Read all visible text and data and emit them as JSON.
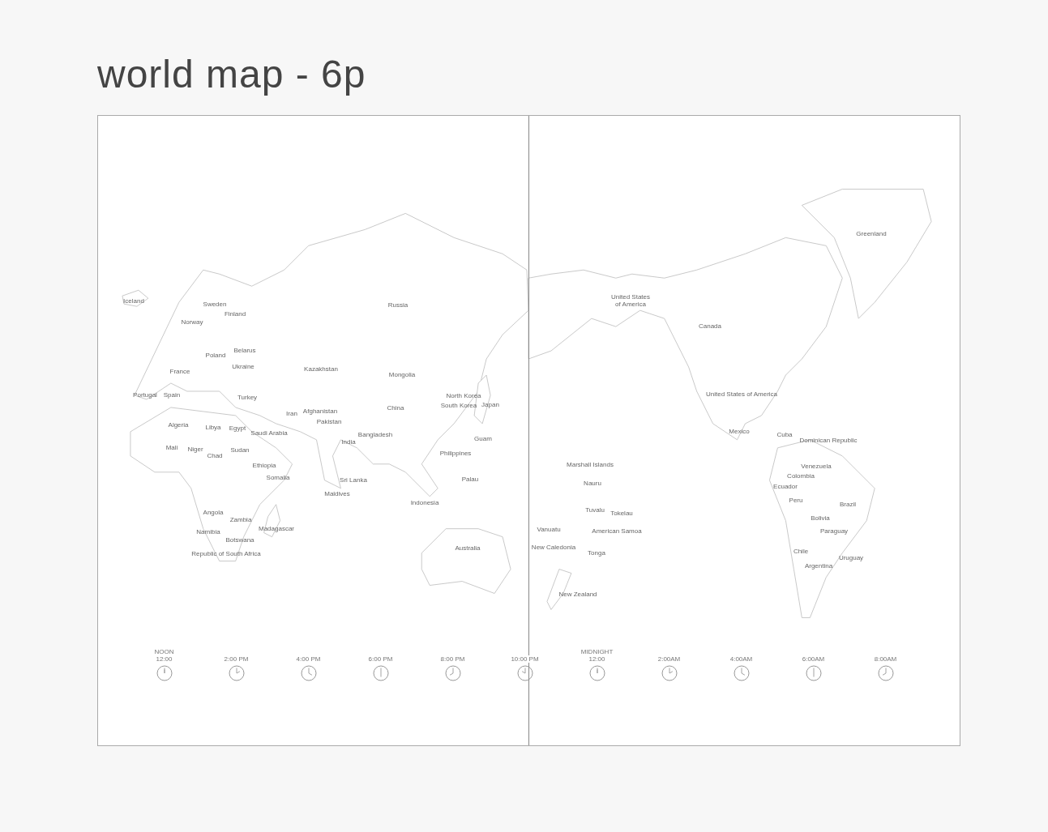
{
  "title": "world map - 6p",
  "map_labels": [
    {
      "lines": [
        "Iceland"
      ]
    },
    {
      "lines": [
        "Sweden"
      ]
    },
    {
      "lines": [
        "Norway"
      ]
    },
    {
      "lines": [
        "Finland"
      ]
    },
    {
      "lines": [
        "Russia"
      ]
    },
    {
      "lines": [
        "Poland"
      ]
    },
    {
      "lines": [
        "Belarus"
      ]
    },
    {
      "lines": [
        "Ukraine"
      ]
    },
    {
      "lines": [
        "France"
      ]
    },
    {
      "lines": [
        "Portugal"
      ]
    },
    {
      "lines": [
        "Spain"
      ]
    },
    {
      "lines": [
        "Turkey"
      ]
    },
    {
      "lines": [
        "Kazakhstan"
      ]
    },
    {
      "lines": [
        "Mongolia"
      ]
    },
    {
      "lines": [
        "China"
      ]
    },
    {
      "lines": [
        "North Korea"
      ]
    },
    {
      "lines": [
        "South Korea"
      ]
    },
    {
      "lines": [
        "Japan"
      ]
    },
    {
      "lines": [
        "Iran"
      ]
    },
    {
      "lines": [
        "Afghanistan"
      ]
    },
    {
      "lines": [
        "Pakistan"
      ]
    },
    {
      "lines": [
        "Algeria"
      ]
    },
    {
      "lines": [
        "Libya"
      ]
    },
    {
      "lines": [
        "Egypt"
      ]
    },
    {
      "lines": [
        "Saudi Arabia"
      ]
    },
    {
      "lines": [
        "India"
      ]
    },
    {
      "lines": [
        "Bangladesh"
      ]
    },
    {
      "lines": [
        "Mali"
      ]
    },
    {
      "lines": [
        "Niger"
      ]
    },
    {
      "lines": [
        "Chad"
      ]
    },
    {
      "lines": [
        "Sudan"
      ]
    },
    {
      "lines": [
        "Ethiopia"
      ]
    },
    {
      "lines": [
        "Somalia"
      ]
    },
    {
      "lines": [
        "Sri Lanka"
      ]
    },
    {
      "lines": [
        "Maldives"
      ]
    },
    {
      "lines": [
        "Philippines"
      ]
    },
    {
      "lines": [
        "Guam"
      ]
    },
    {
      "lines": [
        "Palau"
      ]
    },
    {
      "lines": [
        "Indonesia"
      ]
    },
    {
      "lines": [
        "Angola"
      ]
    },
    {
      "lines": [
        "Zambia"
      ]
    },
    {
      "lines": [
        "Namibia"
      ]
    },
    {
      "lines": [
        "Botswana"
      ]
    },
    {
      "lines": [
        "Madagascar"
      ]
    },
    {
      "lines": [
        "Republic of South Africa"
      ]
    },
    {
      "lines": [
        "Australia"
      ]
    },
    {
      "lines": [
        "New Zealand"
      ]
    },
    {
      "lines": [
        "Marshall Islands"
      ]
    },
    {
      "lines": [
        "Nauru"
      ]
    },
    {
      "lines": [
        "Tuvalu"
      ]
    },
    {
      "lines": [
        "Tokelau"
      ]
    },
    {
      "lines": [
        "Vanuatu"
      ]
    },
    {
      "lines": [
        "American Samoa"
      ]
    },
    {
      "lines": [
        "New Caledonia"
      ]
    },
    {
      "lines": [
        "Tonga"
      ]
    },
    {
      "lines": [
        "Greenland"
      ]
    },
    {
      "lines": [
        "United States",
        "of America"
      ]
    },
    {
      "lines": [
        "Canada"
      ]
    },
    {
      "lines": [
        "United States of America"
      ]
    },
    {
      "lines": [
        "Mexico"
      ]
    },
    {
      "lines": [
        "Cuba"
      ]
    },
    {
      "lines": [
        "Dominican Republic"
      ]
    },
    {
      "lines": [
        "Venezuela"
      ]
    },
    {
      "lines": [
        "Colombia"
      ]
    },
    {
      "lines": [
        "Ecuador"
      ]
    },
    {
      "lines": [
        "Peru"
      ]
    },
    {
      "lines": [
        "Brazil"
      ]
    },
    {
      "lines": [
        "Bolivia"
      ]
    },
    {
      "lines": [
        "Paraguay"
      ]
    },
    {
      "lines": [
        "Chile"
      ]
    },
    {
      "lines": [
        "Uruguay"
      ]
    },
    {
      "lines": [
        "Argentina"
      ]
    }
  ],
  "clocks": [
    {
      "lines": [
        "NOON",
        "12:00"
      ]
    },
    {
      "lines": [
        "2:00 PM"
      ]
    },
    {
      "lines": [
        "4:00 PM"
      ]
    },
    {
      "lines": [
        "6:00 PM"
      ]
    },
    {
      "lines": [
        "8:00 PM"
      ]
    },
    {
      "lines": [
        "10:00 PM"
      ]
    },
    {
      "lines": [
        "MIDNIGHT",
        "12:00"
      ]
    },
    {
      "lines": [
        "2:00AM"
      ]
    },
    {
      "lines": [
        "4:00AM"
      ]
    },
    {
      "lines": [
        "6:00AM"
      ]
    },
    {
      "lines": [
        "8:00AM"
      ]
    }
  ]
}
